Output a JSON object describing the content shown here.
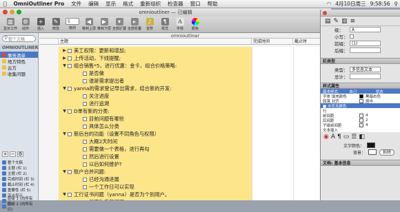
{
  "menubar": {
    "apple": "",
    "app": "OmniOutliner Pro",
    "items": [
      "文件",
      "编辑",
      "显示",
      "格式",
      "重新组织",
      "检查器",
      "窗口",
      "帮助"
    ],
    "clock": "4月10日周三",
    "time": "9:58:56",
    "wifi": "wifi-icon"
  },
  "window": {
    "title": "omnioutliner — 已编辑",
    "doc_name": "omnioutliner"
  },
  "toolbar": {
    "buttons": [
      {
        "label": "显示工作",
        "icon": "sidebar-icon"
      },
      {
        "label": "动作",
        "icon": "gear-icon"
      },
      {
        "label": "插入",
        "icon": "insert-icon"
      },
      {
        "label": "修改",
        "icon": "edit-icon"
      },
      {
        "label": "级别",
        "icon": "level-icon"
      },
      {
        "label": "移到上层",
        "icon": "outdent-icon"
      },
      {
        "label": "移到下层",
        "icon": "indent-icon"
      },
      {
        "label": "全部扩展",
        "icon": "expand-icon"
      },
      {
        "label": "全部折叠",
        "icon": "collapse-icon"
      },
      {
        "label": "音符",
        "icon": "note-icon"
      },
      {
        "label": "样式",
        "icon": "styles-icon"
      },
      {
        "label": "字体",
        "icon": "font-icon"
      },
      {
        "label": "颜色",
        "icon": "color-icon"
      }
    ],
    "level_value": "5"
  },
  "sidebar": {
    "search_placeholder": "整个文稿",
    "section": "OMNIOUTLINER",
    "items": [
      {
        "label": "事务清单",
        "color": "#d94a3b",
        "selected": true
      },
      {
        "label": "地方特色",
        "color": "#f0c040"
      },
      {
        "label": "云方",
        "color": "#f0c040"
      },
      {
        "label": "收集问题",
        "color": "#f0c040"
      }
    ],
    "buttons": [
      "+",
      "−",
      "⚙"
    ],
    "styles": [
      "整个文稿",
      "主题 (栏 1)",
      "主题 (栏 2)",
      "完成时间 (栏 3)",
      "截止时间 (栏 4)",
      "重要性 (栏 5)",
      "突出显示",
      "层级 1 (向所有行)",
      "层级 2 (向所有行)"
    ]
  },
  "columns": {
    "topic": "主题",
    "done": "完成时间",
    "due": "截止时"
  },
  "outline": [
    {
      "level": 1,
      "text": "美工权限：更新和增加;"
    },
    {
      "level": 1,
      "text": "上传活动，下线提醒;"
    },
    {
      "level": 1,
      "text": "组合销售*5，进行优惠：金卡，组合价格策略:",
      "open": true
    },
    {
      "level": 2,
      "text": "是否做"
    },
    {
      "level": 2,
      "text": "谁是需求提出者"
    },
    {
      "level": 1,
      "text": "yanna的需求登记导出需求，结合新的开发:",
      "open": true
    },
    {
      "level": 2,
      "text": "关注进度"
    },
    {
      "level": 2,
      "text": "进行追溯"
    },
    {
      "level": 1,
      "text": "D单有新的分类:",
      "open": true
    },
    {
      "level": 2,
      "text": "目前问题有哪些"
    },
    {
      "level": 2,
      "text": "具体怎么分类"
    },
    {
      "level": 1,
      "text": "新后台的功能（设置不同角色与权限）",
      "open": true
    },
    {
      "level": 2,
      "text": "大概2天时间"
    },
    {
      "level": 2,
      "text": "需要做一个表格，进行再勾"
    },
    {
      "level": 2,
      "text": "然后进行设置"
    },
    {
      "level": 2,
      "text": "以后如何维护?"
    },
    {
      "level": 1,
      "text": "账户合并问题:",
      "open": true
    },
    {
      "level": 2,
      "text": "已经沟通进展"
    },
    {
      "level": 2,
      "text": "一个工作日可以实现"
    },
    {
      "level": 1,
      "text": "工行证书问题（yanna）是否为个别用户。",
      "open": true
    },
    {
      "level": 2,
      "text": "是否为重复问题"
    },
    {
      "level": 2,
      "text": "是否为偶发问题"
    }
  ],
  "inspector": {
    "title": "",
    "fields": [
      {
        "label": "级：",
        "value": "A"
      },
      {
        "label": "小写：",
        "value": ""
      },
      {
        "label": "前缀：",
        "value": "(1)"
      },
      {
        "label": "后缀：",
        "value": ""
      }
    ],
    "section_type": "栏类型",
    "type_label": "类型：",
    "type_value": "多信息文本",
    "sum_label": "总计：",
    "section_style": "样式属性",
    "style_tabs": [
      "基本样式",
      "自己",
      "状态"
    ],
    "style_rows": [
      {
        "name": "字体 填充颜色",
        "value": "黑暗右色",
        "swatch": "#000000"
      },
      {
        "name": "段落 对齐",
        "value": "居中",
        "swatch": "#ffffff"
      },
      {
        "name": "■ 水灰无颜色",
        "value": "",
        "swatch": "#4b78c6",
        "selected": true
      },
      {
        "name": "行",
        "value": "",
        "swatch": ""
      },
      {
        "name": "前间距",
        "value": "4",
        "swatch": "#ffffff"
      },
      {
        "name": "后间距",
        "value": "2",
        "swatch": "#ffffff"
      },
      {
        "name": "子级前间距",
        "value": "4",
        "swatch": "#ffffff"
      },
      {
        "name": "文本插入",
        "value": "",
        "swatch": ""
      }
    ],
    "text_color_label": "文字颜色：",
    "bg_label": "背景：",
    "remove_label": "拆除",
    "bottom_section": "文档: 基本信息"
  }
}
